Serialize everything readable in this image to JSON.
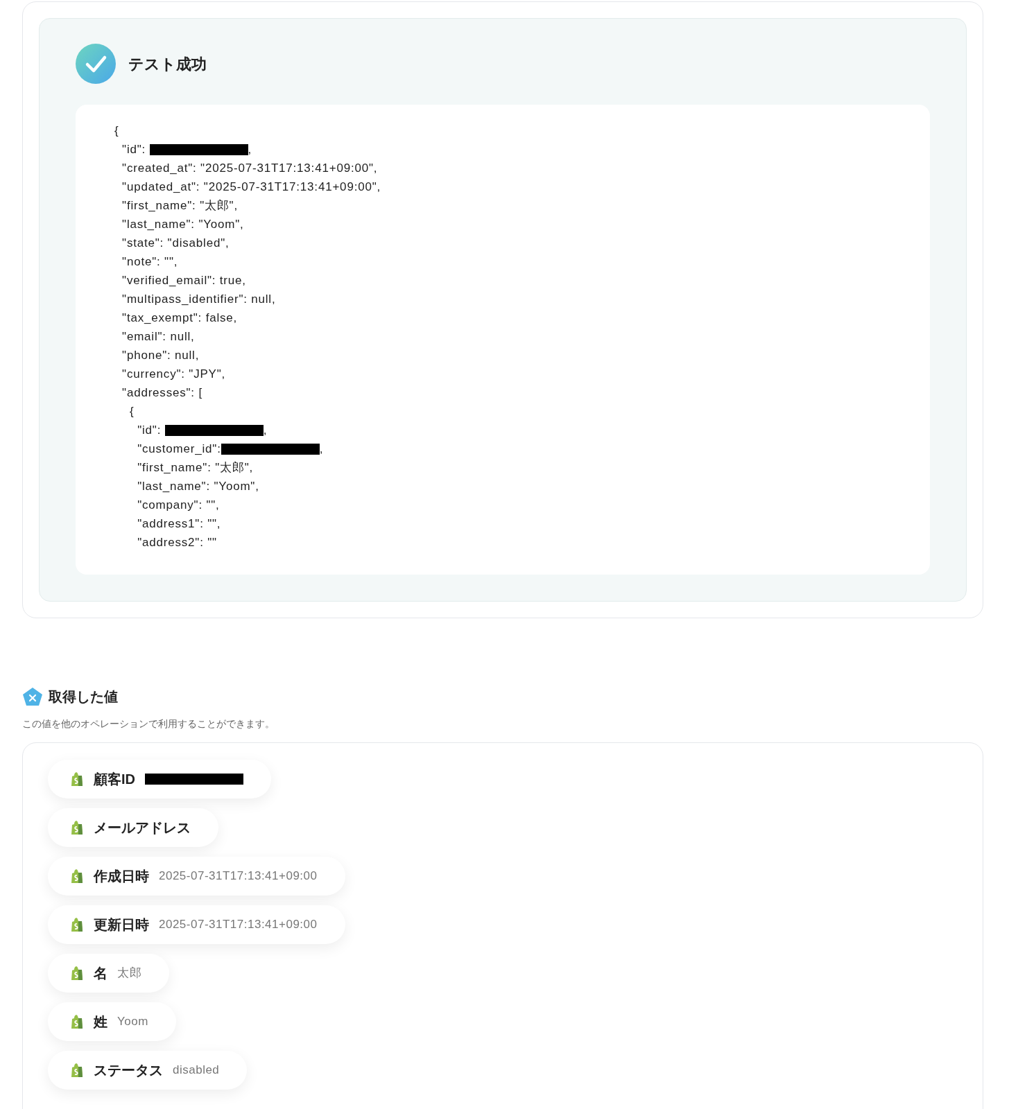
{
  "result": {
    "title": "テスト成功",
    "code_lines": [
      {
        "text": "{"
      },
      {
        "text": "  \"id\": ",
        "redacted": true,
        "after": ","
      },
      {
        "text": "  \"created_at\": \"2025-07-31T17:13:41+09:00\","
      },
      {
        "text": "  \"updated_at\": \"2025-07-31T17:13:41+09:00\","
      },
      {
        "text": "  \"first_name\": \"太郎\","
      },
      {
        "text": "  \"last_name\": \"Yoom\","
      },
      {
        "text": "  \"state\": \"disabled\","
      },
      {
        "text": "  \"note\": \"\","
      },
      {
        "text": "  \"verified_email\": true,"
      },
      {
        "text": "  \"multipass_identifier\": null,"
      },
      {
        "text": "  \"tax_exempt\": false,"
      },
      {
        "text": "  \"email\": null,"
      },
      {
        "text": "  \"phone\": null,"
      },
      {
        "text": "  \"currency\": \"JPY\","
      },
      {
        "text": "  \"addresses\": ["
      },
      {
        "text": "    {"
      },
      {
        "text": "      \"id\": ",
        "redacted": true,
        "after": ","
      },
      {
        "text": "      \"customer_id\":",
        "redacted": true,
        "after": ","
      },
      {
        "text": "      \"first_name\": \"太郎\","
      },
      {
        "text": "      \"last_name\": \"Yoom\","
      },
      {
        "text": "      \"company\": \"\","
      },
      {
        "text": "      \"address1\": \"\","
      },
      {
        "text": "      \"address2\": \"\""
      }
    ]
  },
  "values": {
    "title": "取得した値",
    "description": "この値を他のオペレーションで利用することができます。",
    "items": [
      {
        "label": "顧客ID",
        "redacted": true
      },
      {
        "label": "メールアドレス"
      },
      {
        "label": "作成日時",
        "value": "2025-07-31T17:13:41+09:00"
      },
      {
        "label": "更新日時",
        "value": "2025-07-31T17:13:41+09:00"
      },
      {
        "label": "名",
        "value": "太郎"
      },
      {
        "label": "姓",
        "value": "Yoom"
      },
      {
        "label": "ステータス",
        "value": "disabled"
      }
    ]
  }
}
